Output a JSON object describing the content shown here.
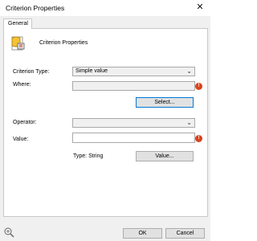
{
  "window": {
    "title": "Criterion Properties"
  },
  "tabs": [
    {
      "label": "General"
    }
  ],
  "header": {
    "label": "Criterion Properties"
  },
  "form": {
    "criterion_type_label": "Criterion Type:",
    "criterion_type_value": "Simple value",
    "where_label": "Where:",
    "where_value": "",
    "select_button": "Select...",
    "operator_label": "Operator:",
    "operator_value": "",
    "value_label": "Value:",
    "value_value": "",
    "type_text": "Type: String",
    "value_button": "Value..."
  },
  "footer": {
    "ok_button": "OK",
    "cancel_button": "Cancel"
  },
  "colors": {
    "error": "#d9431c",
    "focus": "#0078d7",
    "bg": "#f0f0f0"
  },
  "icons": [
    "close-icon",
    "database-properties-icon",
    "chevron-down-icon",
    "error-icon",
    "resize-grip-icon"
  ]
}
